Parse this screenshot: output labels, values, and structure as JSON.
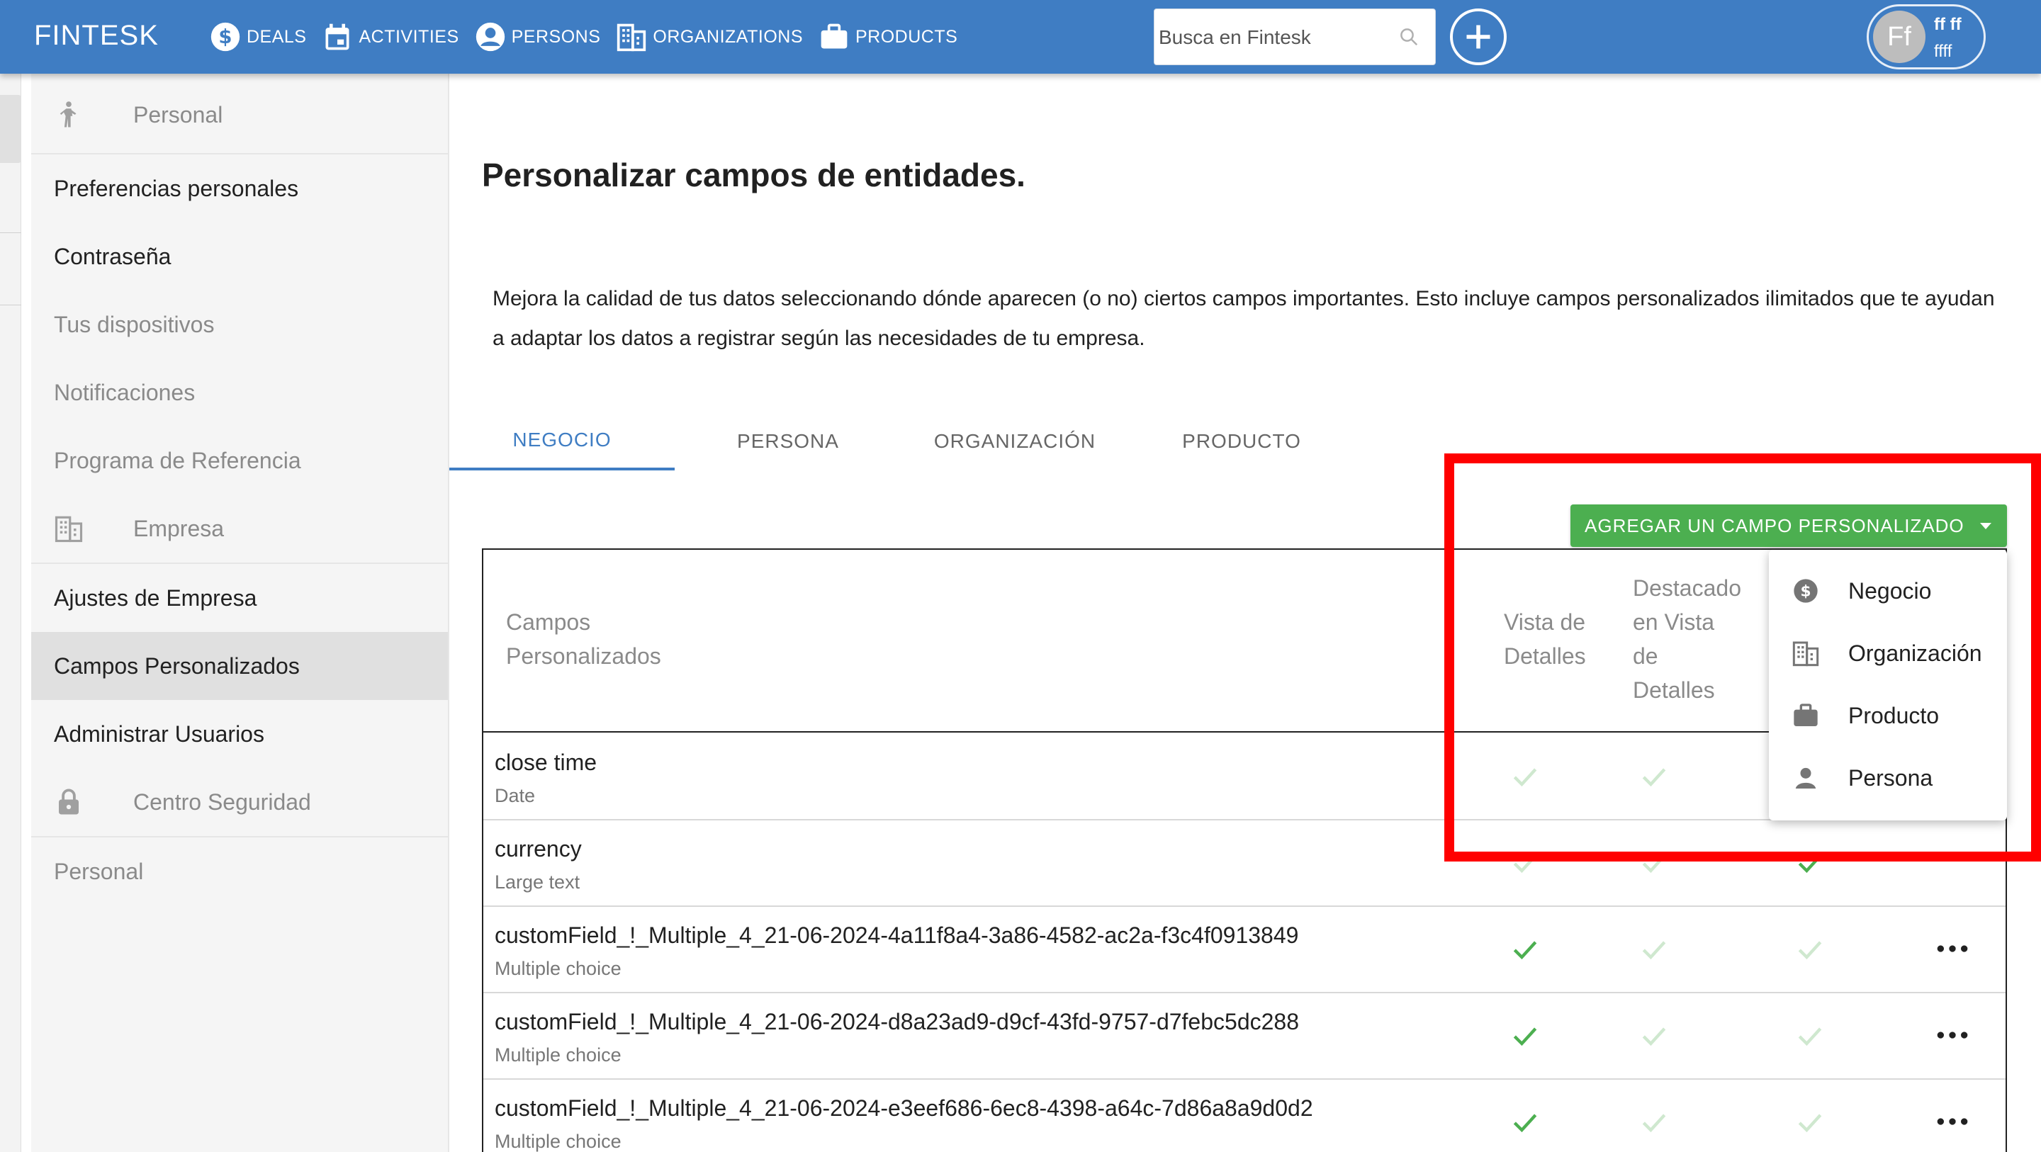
{
  "app": {
    "brand": "FINTESK"
  },
  "nav": [
    {
      "label": "DEALS",
      "icon": "dollar-icon"
    },
    {
      "label": "ACTIVITIES",
      "icon": "calendar-icon"
    },
    {
      "label": "PERSONS",
      "icon": "person-icon"
    },
    {
      "label": "ORGANIZATIONS",
      "icon": "building-icon"
    },
    {
      "label": "PRODUCTS",
      "icon": "briefcase-icon"
    }
  ],
  "search": {
    "placeholder": "Busca en Fintesk",
    "value": ""
  },
  "user": {
    "initials": "Ff",
    "name": "ff ff",
    "sub": "ffff"
  },
  "sidebar": {
    "personal_header": "Personal",
    "items_personal": [
      "Preferencias personales",
      "Contraseña",
      "Tus dispositivos",
      "Notificaciones",
      "Programa de Referencia"
    ],
    "empresa_header": "Empresa",
    "items_empresa": [
      "Ajustes de Empresa",
      "Campos Personalizados",
      "Administrar Usuarios"
    ],
    "seguridad_header": "Centro Seguridad",
    "footer_item": "Personal",
    "active_item": "Campos Personalizados"
  },
  "page": {
    "title": "Personalizar campos de entidades.",
    "description": "Mejora la calidad de tus datos seleccionando dónde aparecen (o no) ciertos campos importantes. Esto incluye campos personalizados ilimitados que te ayudan a adaptar los datos a registrar según las necesidades de tu empresa."
  },
  "tabs": [
    {
      "label": "NEGOCIO",
      "active": true
    },
    {
      "label": "PERSONA",
      "active": false
    },
    {
      "label": "ORGANIZACIÓN",
      "active": false
    },
    {
      "label": "PRODUCTO",
      "active": false
    }
  ],
  "add_button": {
    "label": "AGREGAR UN CAMPO PERSONALIZADO"
  },
  "table": {
    "headers": {
      "campos_line1": "Campos",
      "campos_line2": "Personalizados",
      "vista_line1": "Vista de",
      "vista_line2": "Detalles",
      "destacado_line1": "Destacado",
      "destacado_line2": "en Vista",
      "destacado_line3": "de",
      "destacado_line4": "Detalles"
    },
    "rows": [
      {
        "name": "close time",
        "type": "Date",
        "vista": false,
        "destacado": false,
        "col3": false
      },
      {
        "name": "currency",
        "type": "Large text",
        "vista": false,
        "destacado": false,
        "col3": true
      },
      {
        "name": "customField_!_Multiple_4_21-06-2024-4a11f8a4-3a86-4582-ac2a-f3c4f0913849",
        "type": "Multiple choice",
        "vista": true,
        "destacado": false,
        "col3": false
      },
      {
        "name": "customField_!_Multiple_4_21-06-2024-d8a23ad9-d9cf-43fd-9757-d7febc5dc288",
        "type": "Multiple choice",
        "vista": true,
        "destacado": false,
        "col3": false
      },
      {
        "name": "customField_!_Multiple_4_21-06-2024-e3eef686-6ec8-4398-a64c-7d86a8a9d0d2",
        "type": "Multiple choice",
        "vista": true,
        "destacado": false,
        "col3": false
      }
    ]
  },
  "menu": [
    {
      "label": "Negocio",
      "icon": "dollar-circle-icon"
    },
    {
      "label": "Organización",
      "icon": "building-icon"
    },
    {
      "label": "Producto",
      "icon": "briefcase-icon"
    },
    {
      "label": "Persona",
      "icon": "person-icon"
    }
  ],
  "colors": {
    "topbar": "#3f7dc3",
    "accent_green": "#4caf50",
    "check_active": "#4caf50",
    "check_inactive": "#cfe8cf",
    "highlight_red": "#ff0000"
  }
}
